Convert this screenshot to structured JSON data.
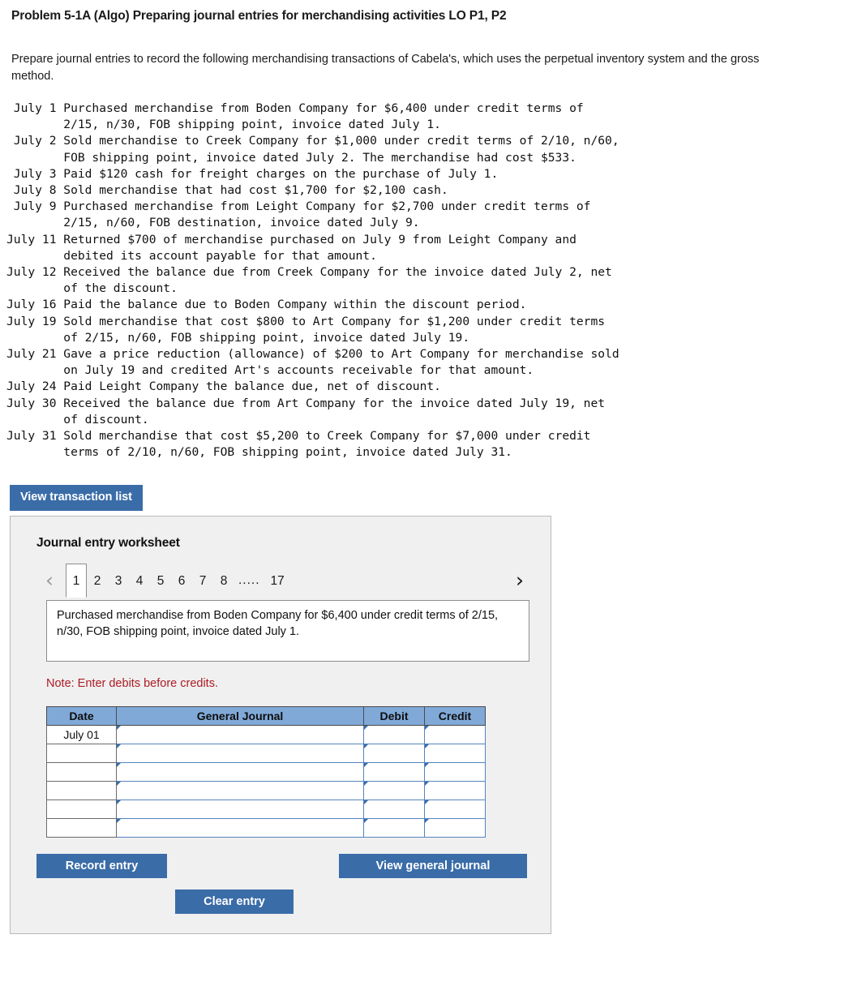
{
  "problem": {
    "title": "Problem 5-1A (Algo) Preparing journal entries for merchandising activities LO P1, P2",
    "instructions": "Prepare journal entries to record the following merchandising transactions of Cabela's, which uses the perpetual inventory system and the gross method."
  },
  "transactions": [
    " July 1 Purchased merchandise from Boden Company for $6,400 under credit terms of\n        2/15, n/30, FOB shipping point, invoice dated July 1.",
    " July 2 Sold merchandise to Creek Company for $1,000 under credit terms of 2/10, n/60,\n        FOB shipping point, invoice dated July 2. The merchandise had cost $533.",
    " July 3 Paid $120 cash for freight charges on the purchase of July 1.",
    " July 8 Sold merchandise that had cost $1,700 for $2,100 cash.",
    " July 9 Purchased merchandise from Leight Company for $2,700 under credit terms of\n        2/15, n/60, FOB destination, invoice dated July 9.",
    "July 11 Returned $700 of merchandise purchased on July 9 from Leight Company and\n        debited its account payable for that amount.",
    "July 12 Received the balance due from Creek Company for the invoice dated July 2, net\n        of the discount.",
    "July 16 Paid the balance due to Boden Company within the discount period.",
    "July 19 Sold merchandise that cost $800 to Art Company for $1,200 under credit terms\n        of 2/15, n/60, FOB shipping point, invoice dated July 19.",
    "July 21 Gave a price reduction (allowance) of $200 to Art Company for merchandise sold\n        on July 19 and credited Art's accounts receivable for that amount.",
    "July 24 Paid Leight Company the balance due, net of discount.",
    "July 30 Received the balance due from Art Company for the invoice dated July 19, net\n        of discount.",
    "July 31 Sold merchandise that cost $5,200 to Creek Company for $7,000 under credit\n        terms of 2/10, n/60, FOB shipping point, invoice dated July 31."
  ],
  "buttons": {
    "view_transaction_list": "View transaction list",
    "record_entry": "Record entry",
    "clear_entry": "Clear entry",
    "view_general_journal": "View general journal"
  },
  "worksheet": {
    "title": "Journal entry worksheet",
    "pager": {
      "prev_icon": "chevron-left",
      "next_icon": "chevron-right",
      "pages": [
        "1",
        "2",
        "3",
        "4",
        "5",
        "6",
        "7",
        "8"
      ],
      "ellipsis": ".....",
      "last_page": "17",
      "active_page": "1"
    },
    "transaction_description": "Purchased merchandise from Boden Company for $6,400 under credit terms of 2/15, n/30, FOB shipping point, invoice dated July 1.",
    "note": "Note: Enter debits before credits.",
    "table": {
      "headers": [
        "Date",
        "General Journal",
        "Debit",
        "Credit"
      ],
      "rows": [
        {
          "date": "July 01",
          "general_journal": "",
          "debit": "",
          "credit": ""
        },
        {
          "date": "",
          "general_journal": "",
          "debit": "",
          "credit": ""
        },
        {
          "date": "",
          "general_journal": "",
          "debit": "",
          "credit": ""
        },
        {
          "date": "",
          "general_journal": "",
          "debit": "",
          "credit": ""
        },
        {
          "date": "",
          "general_journal": "",
          "debit": "",
          "credit": ""
        },
        {
          "date": "",
          "general_journal": "",
          "debit": "",
          "credit": ""
        }
      ]
    }
  },
  "colors": {
    "button_blue": "#3a6ca8",
    "table_header_blue": "#80a9d8",
    "note_red": "#ab1c24",
    "panel_bg": "#f0f0f0"
  }
}
